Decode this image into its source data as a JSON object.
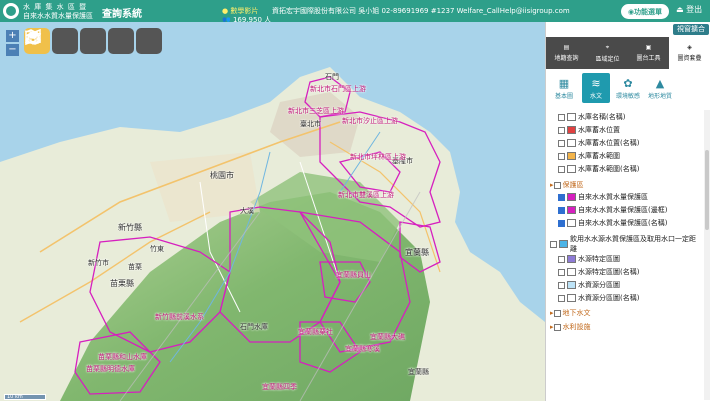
{
  "header": {
    "org_line1": "水 庫 集 水 區 暨",
    "org_line2": "自來水水質水量保護區",
    "system_title": "查詢系統",
    "news": "數學影片",
    "counter": "169,950 人",
    "contact": "資拓宏宇國際股份有限公司 吳小姐 02-89691969 #1237 Welfare_CallHelp@iisigroup.com",
    "function_menu": "功能選單",
    "logout": "登出"
  },
  "colors": {
    "header": "#2e9f8a",
    "boundary": "#d61fbf",
    "sea": "#a8d3ea"
  },
  "map": {
    "zoom_in": "+",
    "zoom_out": "−",
    "tools": [
      {
        "icon": "map-fold-icon"
      },
      {
        "icon": "cable-car-icon"
      },
      {
        "icon": "map-3d-icon"
      },
      {
        "icon": "grid-3d-icon"
      },
      {
        "icon": "layers-stack-icon"
      }
    ],
    "scale": "10 km",
    "labels": [
      {
        "t": "石門"
      },
      {
        "t": "新北市石門區上游"
      },
      {
        "t": "新北市三芝區上游"
      },
      {
        "t": "臺北市"
      },
      {
        "t": "新北市汐止區上游"
      },
      {
        "t": "基隆市"
      },
      {
        "t": "新北市坪林區上游"
      },
      {
        "t": "新北市雙溪區上游"
      },
      {
        "t": "新竹縣"
      },
      {
        "t": "新竹市"
      },
      {
        "t": "苗栗縣"
      },
      {
        "t": "新竹縣前溪水系"
      },
      {
        "t": "石門水庫"
      },
      {
        "t": "苗栗縣和山水庫"
      },
      {
        "t": "苗栗縣明德水庫"
      },
      {
        "t": "宜蘭縣"
      },
      {
        "t": "宜蘭縣員山"
      },
      {
        "t": "宜蘭縣粟社"
      },
      {
        "t": "宜蘭縣大礁"
      },
      {
        "t": "宜蘭縣寒溪"
      },
      {
        "t": "宜蘭縣四季"
      },
      {
        "t": "宜蘭縣"
      },
      {
        "t": "桃園市"
      },
      {
        "t": "大溪"
      },
      {
        "t": "竹東"
      },
      {
        "t": "苗栗"
      }
    ]
  },
  "panel": {
    "basemap_switch": "視窗擴合",
    "tabs": [
      {
        "label": "地籍查詢",
        "icon": "parcel-search-icon"
      },
      {
        "label": "區域定位",
        "icon": "locate-icon"
      },
      {
        "label": "圖台工具",
        "icon": "toolbox-icon"
      },
      {
        "label": "圖資套疊",
        "icon": "layers-icon"
      }
    ],
    "subtabs": [
      {
        "label": "基本圖",
        "icon": "basemap-icon"
      },
      {
        "label": "水文",
        "icon": "water-wave-icon"
      },
      {
        "label": "環境敏感",
        "icon": "environment-icon"
      },
      {
        "label": "地形地質",
        "icon": "terrain-icon"
      }
    ],
    "layers": [
      {
        "label": "水庫名稱(名稱)",
        "indent": 1,
        "checked": false,
        "swatch": "#ffffff"
      },
      {
        "label": "水庫蓄水位置",
        "indent": 1,
        "checked": false,
        "swatch": "#e04040"
      },
      {
        "label": "水庫蓄水位置(名稱)",
        "indent": 1,
        "checked": false,
        "swatch": "#ffffff"
      },
      {
        "label": "水庫蓄水範圍",
        "indent": 1,
        "checked": false,
        "swatch": "#f3b44a"
      },
      {
        "label": "水庫蓄水範圍(名稱)",
        "indent": 1,
        "checked": false,
        "swatch": "#ffffff"
      },
      {
        "label": "保護區",
        "indent": 0,
        "checked": false,
        "swatch": "",
        "group": true
      },
      {
        "label": "自來水水質水量保護區",
        "indent": 1,
        "checked": true,
        "swatch": "#d61fbf"
      },
      {
        "label": "自來水水質水量保護區(邊框)",
        "indent": 1,
        "checked": true,
        "swatch": "#d61fbf"
      },
      {
        "label": "自來水水質水量保護區(名稱)",
        "indent": 1,
        "checked": true,
        "swatch": "#ffffff"
      },
      {
        "label": "飲用水水源水質保護區及取用水口一定距離",
        "indent": 0,
        "checked": false,
        "swatch": "#4bb3e6"
      },
      {
        "label": "水源特定區圖",
        "indent": 1,
        "checked": false,
        "swatch": "#8e7bd6"
      },
      {
        "label": "水源特定區圖(名稱)",
        "indent": 1,
        "checked": false,
        "swatch": "#ffffff"
      },
      {
        "label": "水資源分區圖",
        "indent": 1,
        "checked": false,
        "swatch": "#bde3f7"
      },
      {
        "label": "水資源分區圖(名稱)",
        "indent": 1,
        "checked": false,
        "swatch": "#ffffff"
      },
      {
        "label": "地下水文",
        "indent": 0,
        "checked": false,
        "swatch": "",
        "group": true
      },
      {
        "label": "水利設施",
        "indent": 0,
        "checked": false,
        "swatch": "",
        "group": true
      }
    ]
  }
}
